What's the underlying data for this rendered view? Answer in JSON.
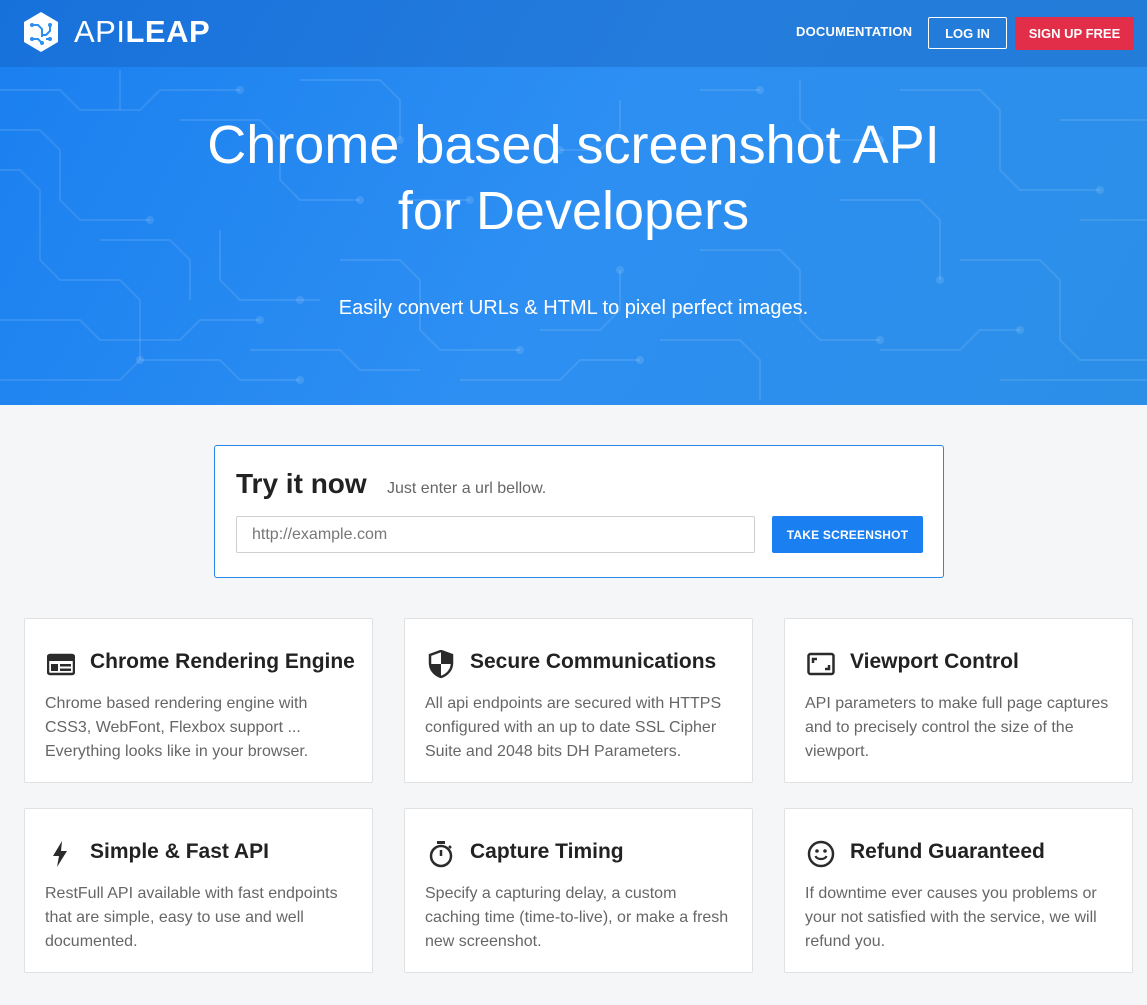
{
  "brand": {
    "name_light": "API",
    "name_bold": "LEAP"
  },
  "nav": {
    "documentation": "DOCUMENTATION",
    "login": "LOG IN",
    "signup": "SIGN UP FREE"
  },
  "hero": {
    "title_line1": "Chrome based screenshot API",
    "title_line2": "for Developers",
    "subtitle": "Easily convert URLs & HTML to pixel perfect images."
  },
  "try": {
    "title": "Try it now",
    "hint": "Just enter a url bellow.",
    "placeholder": "http://example.com",
    "button": "TAKE SCREENSHOT"
  },
  "features": [
    {
      "icon": "browser-window-icon",
      "title": "Chrome Rendering Engine",
      "text": "Chrome based rendering engine with CSS3, WebFont, Flexbox support ... Everything looks like in your browser."
    },
    {
      "icon": "shield-icon",
      "title": "Secure Communications",
      "text": "All api endpoints are secured with HTTPS configured with an up to date SSL Cipher Suite and 2048 bits DH Parameters."
    },
    {
      "icon": "viewport-icon",
      "title": "Viewport Control",
      "text": "API parameters to make full page captures and to precisely control the size of the viewport."
    },
    {
      "icon": "lightning-icon",
      "title": "Simple & Fast API",
      "text": "RestFull API available with fast endpoints that are simple, easy to use and well documented."
    },
    {
      "icon": "stopwatch-icon",
      "title": "Capture Timing",
      "text": "Specify a capturing delay, a custom caching time (time-to-live), or make a fresh new screenshot."
    },
    {
      "icon": "smiley-icon",
      "title": "Refund Guaranteed",
      "text": "If downtime ever causes you problems or your not satisfied with the service, we will refund you."
    }
  ],
  "colors": {
    "primary": "#1a7ff0",
    "signup": "#e22e48",
    "background": "#f5f6f7"
  }
}
